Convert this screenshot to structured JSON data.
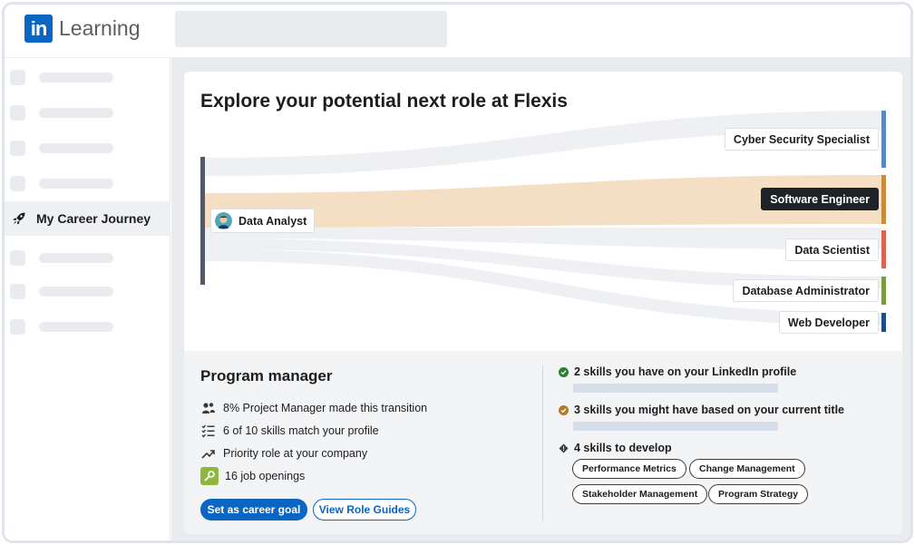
{
  "brand": {
    "logo_mark": "in",
    "product": "Learning"
  },
  "sidebar": {
    "active_item": {
      "label": "My Career Journey",
      "icon": "rocket-icon"
    }
  },
  "card": {
    "title": "Explore your potential next role at Flexis",
    "source_role": "Data Analyst",
    "target_roles": [
      {
        "label": "Cyber Security Specialist",
        "color": "#5b87c4"
      },
      {
        "label": "Software Engineer",
        "color": "#c98a3c",
        "selected": true
      },
      {
        "label": "Data Scientist",
        "color": "#d9674e"
      },
      {
        "label": "Database Administrator",
        "color": "#7c9a3f"
      },
      {
        "label": "Web Developer",
        "color": "#1f4b8f"
      }
    ]
  },
  "detail": {
    "role_title": "Program manager",
    "stats": [
      {
        "icon": "people-icon",
        "text": "8% Project Manager made this transition"
      },
      {
        "icon": "checklist-icon",
        "text": "6 of 10 skills match your profile"
      },
      {
        "icon": "trending-icon",
        "text": "Priority role at your company"
      },
      {
        "icon": "job-icon",
        "text": "16 job openings"
      }
    ],
    "primary_button": "Set as career goal",
    "secondary_button": "View Role Guides"
  },
  "skills": {
    "have": {
      "text": "2 skills you have on your LinkedIn profile",
      "color": "#2e7d32"
    },
    "might_have": {
      "text": "3 skills you might have based on your current title",
      "color": "#b07c2a"
    },
    "develop": {
      "text": "4 skills to develop",
      "items": [
        "Performance Metrics",
        "Change Management",
        "Stakeholder Management",
        "Program Strategy"
      ]
    }
  }
}
